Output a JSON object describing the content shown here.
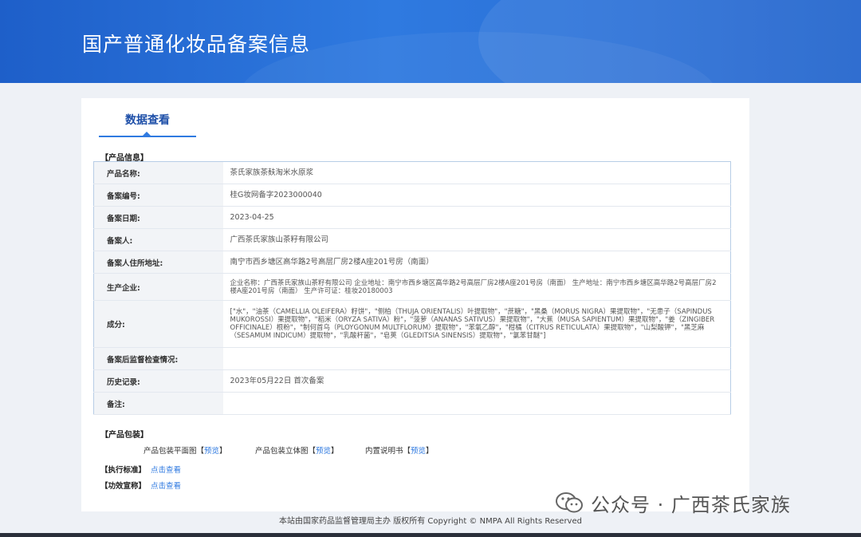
{
  "header": {
    "title": "国产普通化妆品备案信息"
  },
  "tabs": [
    {
      "label": "数据查看"
    }
  ],
  "product_info": {
    "section_title": "【产品信息】",
    "rows": [
      {
        "label": "产品名称:",
        "value": "茶氏家族茶麸淘米水原浆"
      },
      {
        "label": "备案编号:",
        "value": "桂G妆网备字2023000040"
      },
      {
        "label": "备案日期:",
        "value": "2023-04-25"
      },
      {
        "label": "备案人:",
        "value": "广西茶氏家族山茶籽有限公司"
      },
      {
        "label": "备案人住所地址:",
        "value": "南宁市西乡塘区高华路2号高层厂房2楼A座201号房（南面）"
      },
      {
        "label": "生产企业:",
        "value": "企业名称：广西茶氏家族山茶籽有限公司 企业地址：南宁市西乡塘区高华路2号高层厂房2楼A座201号房（南面） 生产地址：南宁市西乡塘区高华路2号高层厂房2楼A座201号房（南面） 生产许可证：桂妆20180003"
      },
      {
        "label": "成分:",
        "value": "[\"水\"，\"油茶（CAMELLIA OLEIFERA）籽饼\"，\"侧柏（THUJA ORIENTALIS）叶提取物\"，\"蔗糖\"，\"黑桑（MORUS NIGRA）果提取物\"，\"无患子（SAPINDUS MUKOROSSI）果提取物\"，\"稻米（ORYZA SATIVA）粉\"，\"菠萝（ANANAS SATIVUS）果提取物\"，\"大蕉（MUSA SAPIENTUM）果提取物\"，\"姜（ZINGIBER OFFICINALE）根粉\"，\"制何首乌（PLOYGONUM MULTFLORUM）提取物\"，\"苯氧乙醇\"，\"柑橘（CITRUS RETICULATA）果提取物\"，\"山梨酸钾\"，\"黑芝麻（SESAMUM INDICUM）提取物\"，\"乳酸杆菌\"，\"皂荚（GLEDITSIA SINENSIS）提取物\"，\"氯苯甘醚\"]"
      },
      {
        "label": "备案后监督检查情况:",
        "value": ""
      },
      {
        "label": "历史记录:",
        "value": "2023年05月22日 首次备案"
      },
      {
        "label": "备注:",
        "value": ""
      }
    ]
  },
  "packaging": {
    "section_title": "【产品包装】",
    "items": [
      {
        "label": "产品包装平面图",
        "bracket_open": "【",
        "link": "预览",
        "bracket_close": "】"
      },
      {
        "label": "产品包装立体图",
        "bracket_open": "【",
        "link": "预览",
        "bracket_close": "】"
      },
      {
        "label": "内置说明书",
        "bracket_open": "【",
        "link": "预览",
        "bracket_close": "】"
      }
    ]
  },
  "standard": {
    "title": "【执行标准】",
    "link": "点击查看"
  },
  "efficacy": {
    "title": "【功效宣称】",
    "link": "点击查看"
  },
  "footer": {
    "text": "本站由国家药品监督管理局主办 版权所有 Copyright © NMPA All Rights Reserved"
  },
  "watermark": {
    "text": "公众号 · 广西茶氏家族",
    "icon": "wechat-icon"
  },
  "colors": {
    "header": "#2f7ae0",
    "link": "#2f7ae0",
    "label_bg": "#f2f4f7",
    "border": "#b7cde6"
  }
}
